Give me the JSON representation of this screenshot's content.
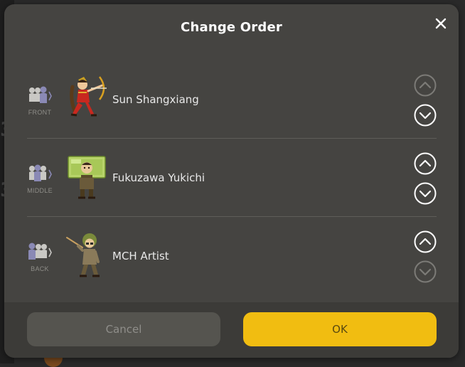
{
  "dialog": {
    "title": "Change Order",
    "close_icon": "close-icon"
  },
  "rows": [
    {
      "position": "FRONT",
      "name": "Sun Shangxiang",
      "up_enabled": false,
      "down_enabled": true
    },
    {
      "position": "MIDDLE",
      "name": "Fukuzawa Yukichi",
      "up_enabled": true,
      "down_enabled": true
    },
    {
      "position": "BACK",
      "name": "MCH Artist",
      "up_enabled": true,
      "down_enabled": false
    }
  ],
  "buttons": {
    "cancel": "Cancel",
    "ok": "OK"
  },
  "colors": {
    "accent": "#f1bd11",
    "modal_bg": "#454441",
    "disabled_arrow": "#7c7b77",
    "enabled_arrow": "#ffffff"
  }
}
